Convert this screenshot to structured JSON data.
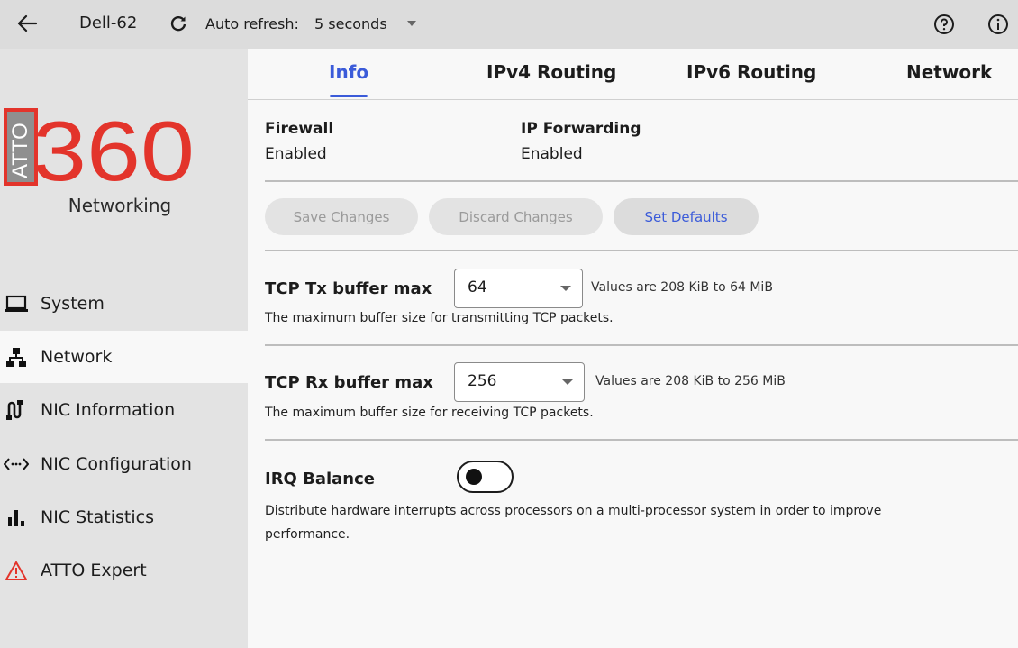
{
  "topbar": {
    "host": "Dell-62",
    "auto_refresh_label": "Auto refresh:",
    "auto_refresh_value": "5 seconds"
  },
  "sidebar": {
    "logo_text": "360",
    "logo_badge": "ATTO",
    "logo_subtitle": "Networking",
    "items": [
      {
        "label": "System",
        "icon": "laptop-icon"
      },
      {
        "label": "Network",
        "icon": "network-icon"
      },
      {
        "label": "NIC Information",
        "icon": "nic-information-icon"
      },
      {
        "label": "NIC Configuration",
        "icon": "nic-configuration-icon"
      },
      {
        "label": "NIC Statistics",
        "icon": "bar-chart-icon"
      },
      {
        "label": "ATTO Expert",
        "icon": "warning-icon"
      }
    ],
    "active": "Network"
  },
  "tabs": [
    {
      "label": "Info"
    },
    {
      "label": "IPv4 Routing"
    },
    {
      "label": "IPv6 Routing"
    },
    {
      "label": "Network"
    }
  ],
  "status": {
    "firewall_label": "Firewall",
    "firewall_value": "Enabled",
    "ip_forwarding_label": "IP Forwarding",
    "ip_forwarding_value": "Enabled"
  },
  "actions": {
    "save": "Save Changes",
    "discard": "Discard Changes",
    "defaults": "Set Defaults"
  },
  "tcp_tx": {
    "title": "TCP Tx buffer max",
    "value": "64",
    "hint": "Values are 208 KiB to 64 MiB",
    "desc": "The maximum buffer size for transmitting TCP packets."
  },
  "tcp_rx": {
    "title": "TCP Rx buffer max",
    "value": "256",
    "hint": "Values are 208 KiB to 256 MiB",
    "desc": "The maximum buffer size for receiving TCP packets."
  },
  "irq": {
    "title": "IRQ Balance",
    "enabled": false,
    "desc_line1": "Distribute hardware interrupts across processors on a multi-processor system in order to improve",
    "desc_line2": "performance."
  },
  "colors": {
    "accent": "#3b5bd9",
    "logo_red": "#e3342b",
    "warning": "#e3342b"
  }
}
